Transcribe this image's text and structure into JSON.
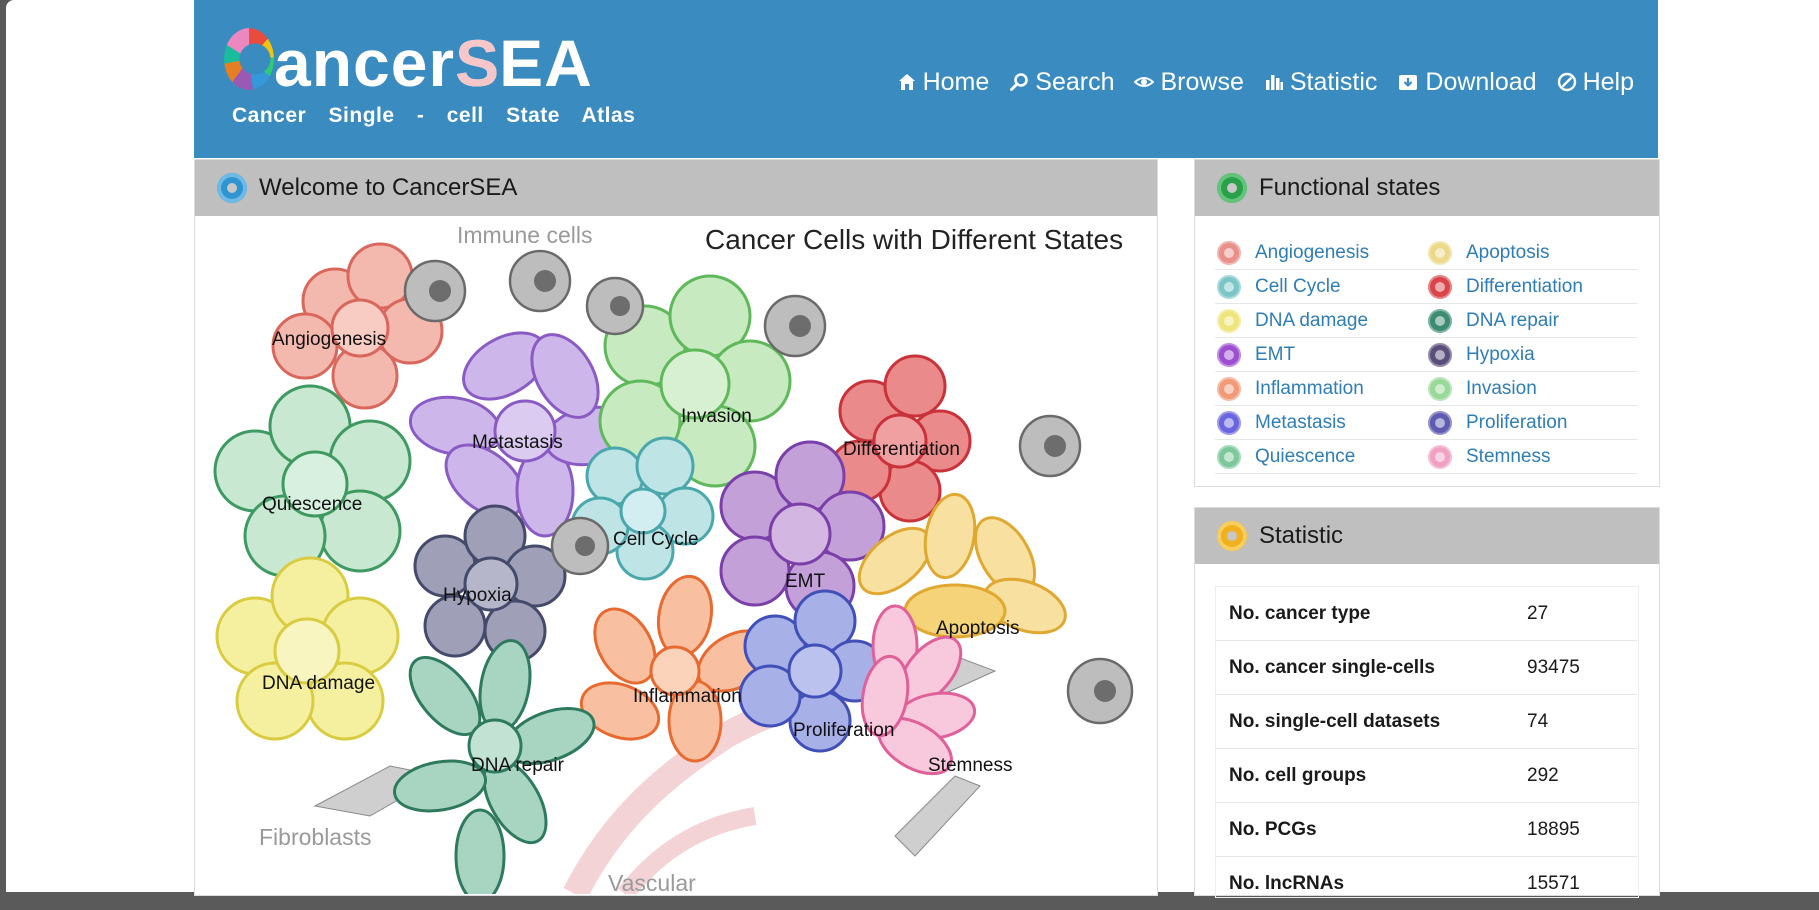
{
  "logo": {
    "title_part1": "ancer",
    "title_part2": "S",
    "title_part3": "EA",
    "subtitle": "Cancer Single - cell State Atlas"
  },
  "nav": [
    {
      "label": "Home",
      "icon": "home-icon"
    },
    {
      "label": "Search",
      "icon": "search-icon"
    },
    {
      "label": "Browse",
      "icon": "eye-icon"
    },
    {
      "label": "Statistic",
      "icon": "bar-chart-icon"
    },
    {
      "label": "Download",
      "icon": "download-icon"
    },
    {
      "label": "Help",
      "icon": "help-icon"
    }
  ],
  "welcome": {
    "title": "Welcome to CancerSEA",
    "illustration": {
      "title": "Cancer Cells with Different States",
      "outside_labels": {
        "immune": "Immune cells",
        "fibroblasts": "Fibroblasts",
        "vascular": "Vascular"
      },
      "states": {
        "angiogenesis": "Angiogenesis",
        "metastasis": "Metastasis",
        "invasion": "Invasion",
        "differentiation": "Differentiation",
        "quiescence": "Quiescence",
        "cell_cycle": "Cell Cycle",
        "hypoxia": "Hypoxia",
        "emt": "EMT",
        "apoptosis": "Apoptosis",
        "dna_damage": "DNA damage",
        "inflammation": "Inflammation",
        "proliferation": "Proliferation",
        "stemness": "Stemness",
        "dna_repair": "DNA repair"
      }
    }
  },
  "functional_states": {
    "title": "Functional states",
    "items": [
      {
        "label": "Angiogenesis",
        "color": "#e8908a"
      },
      {
        "label": "Apoptosis",
        "color": "#ecd98a"
      },
      {
        "label": "Cell Cycle",
        "color": "#7cc6c8"
      },
      {
        "label": "Differentiation",
        "color": "#d9454a"
      },
      {
        "label": "DNA damage",
        "color": "#eee57a"
      },
      {
        "label": "DNA repair",
        "color": "#3d8c72"
      },
      {
        "label": "EMT",
        "color": "#9c4fd0"
      },
      {
        "label": "Hypoxia",
        "color": "#5a4f7a"
      },
      {
        "label": "Inflammation",
        "color": "#f19a78"
      },
      {
        "label": "Invasion",
        "color": "#98d898"
      },
      {
        "label": "Metastasis",
        "color": "#6a66e0"
      },
      {
        "label": "Proliferation",
        "color": "#5f5bb0"
      },
      {
        "label": "Quiescence",
        "color": "#7cc89a"
      },
      {
        "label": "Stemness",
        "color": "#f0a0c0"
      }
    ]
  },
  "statistic": {
    "title": "Statistic",
    "rows": [
      {
        "key": "No. cancer type",
        "value": "27"
      },
      {
        "key": "No. cancer single-cells",
        "value": "93475"
      },
      {
        "key": "No. single-cell datasets",
        "value": "74"
      },
      {
        "key": "No. cell groups",
        "value": "292"
      },
      {
        "key": "No. PCGs",
        "value": "18895"
      },
      {
        "key": "No. lncRNAs",
        "value": "15571"
      }
    ]
  },
  "colors": {
    "header": "#3a8bbf",
    "link": "#2f7db5",
    "panel_head": "#bfbfbf"
  }
}
